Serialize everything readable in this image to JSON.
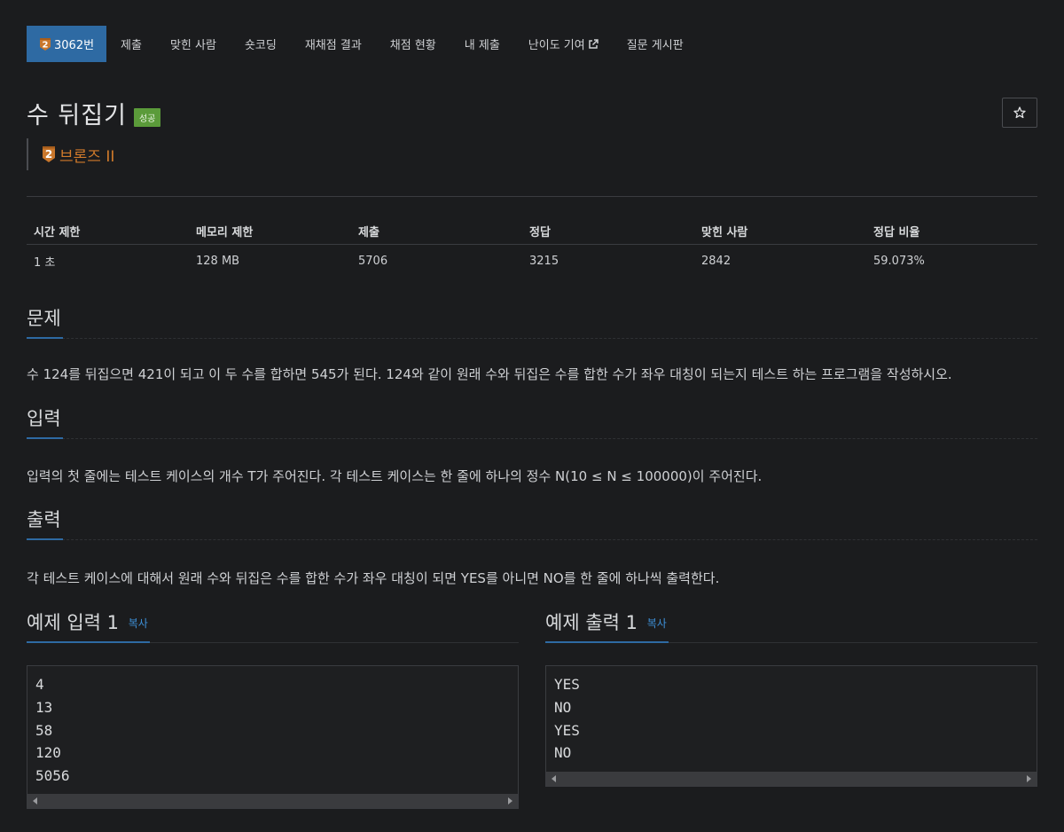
{
  "nav": {
    "items": [
      {
        "label": "3062번",
        "active": true,
        "icon": "bronze-tier-icon"
      },
      {
        "label": "제출"
      },
      {
        "label": "맞힌 사람"
      },
      {
        "label": "숏코딩"
      },
      {
        "label": "재채점 결과"
      },
      {
        "label": "채점 현황"
      },
      {
        "label": "내 제출"
      },
      {
        "label": "난이도 기여",
        "icon": "external-link-icon"
      },
      {
        "label": "질문 게시판"
      }
    ]
  },
  "problem": {
    "title": "수 뒤집기",
    "status_badge": "성공",
    "tier": "브론즈 II",
    "tier_number": "2",
    "tier_color": "#d07a2b"
  },
  "stats": {
    "headers": [
      "시간 제한",
      "메모리 제한",
      "제출",
      "정답",
      "맞힌 사람",
      "정답 비율"
    ],
    "values": [
      "1 초",
      "128 MB",
      "5706",
      "3215",
      "2842",
      "59.073%"
    ]
  },
  "sections": {
    "problem_heading": "문제",
    "problem_text": "수 124를 뒤집으면 421이 되고 이 두 수를 합하면 545가 된다. 124와 같이 원래 수와 뒤집은 수를 합한 수가 좌우 대칭이 되는지 테스트 하는 프로그램을 작성하시오.",
    "input_heading": "입력",
    "input_text": "입력의 첫 줄에는 테스트 케이스의 개수 T가 주어진다. 각 테스트 케이스는 한 줄에 하나의 정수 N(10 ≤ N ≤ 100000)이 주어진다.",
    "output_heading": "출력",
    "output_text": "각 테스트 케이스에 대해서 원래 수와 뒤집은 수를 합한 수가 좌우 대칭이 되면 YES를 아니면 NO를 한 줄에 하나씩 출력한다."
  },
  "examples": {
    "input_heading": "예제 입력 1",
    "output_heading": "예제 출력 1",
    "copy_label": "복사",
    "input_lines": "4\n13\n58\n120\n5056",
    "output_lines": "YES\nNO\nYES\nNO"
  },
  "colors": {
    "accent": "#2e6aa3",
    "success": "#5b9b3a",
    "bronze": "#d07a2b",
    "link": "#3d8fd6"
  }
}
